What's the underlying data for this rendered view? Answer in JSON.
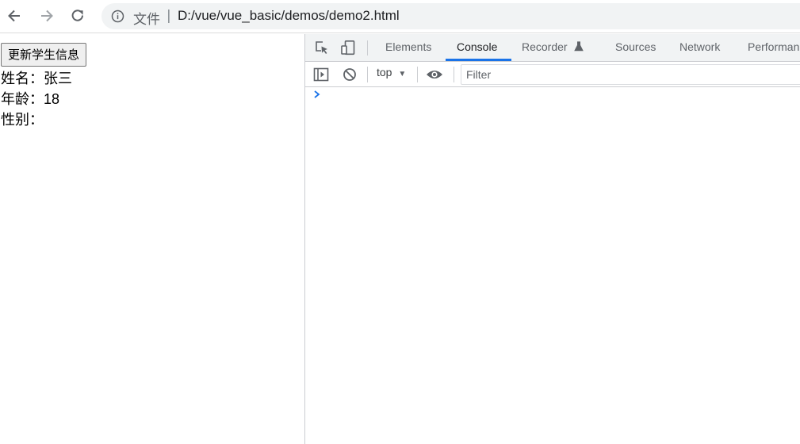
{
  "browser": {
    "address_scheme": "文件",
    "address_separator": "|",
    "url": "D:/vue/vue_basic/demos/demo2.html"
  },
  "page": {
    "update_button_label": "更新学生信息",
    "fields": [
      {
        "label": "姓名：",
        "value": "张三"
      },
      {
        "label": "年龄：",
        "value": "18"
      },
      {
        "label": "性别：",
        "value": ""
      }
    ]
  },
  "devtools": {
    "tabs": [
      {
        "label": "Elements",
        "active": false
      },
      {
        "label": "Console",
        "active": true
      },
      {
        "label": "Recorder",
        "active": false
      },
      {
        "label": "Sources",
        "active": false
      },
      {
        "label": "Network",
        "active": false
      },
      {
        "label": "Performan",
        "active": false
      }
    ],
    "context": "top",
    "filter_placeholder": "Filter",
    "accent_color": "#1a73e8"
  }
}
